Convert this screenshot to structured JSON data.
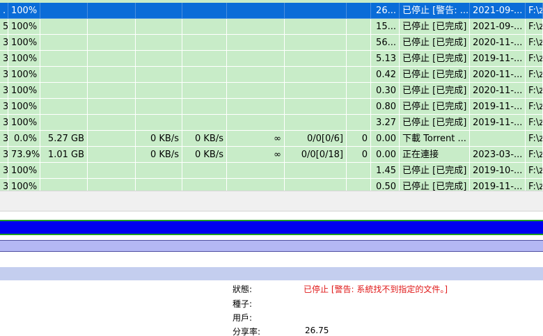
{
  "colors": {
    "selected_row": "#0a6cd8",
    "row_bg": "#c8ecc8",
    "progress": "#0000f0",
    "error_text": "#e01818"
  },
  "rows": [
    {
      "c0": ".",
      "progress": "100%",
      "size": "",
      "down_speed": "",
      "up_speed": "",
      "eta": "",
      "seeds": "",
      "peers": "",
      "ratio": "26...",
      "status": "已停止 [警告: ...",
      "added": "2021-09-...",
      "path": "F:\\z"
    },
    {
      "c0": "5",
      "progress": "100%",
      "size": "",
      "down_speed": "",
      "up_speed": "",
      "eta": "",
      "seeds": "",
      "peers": "",
      "ratio": "15...",
      "status": "已停止 [已完成]",
      "added": "2021-09-...",
      "path": "F:\\z"
    },
    {
      "c0": "3",
      "progress": "100%",
      "size": "",
      "down_speed": "",
      "up_speed": "",
      "eta": "",
      "seeds": "",
      "peers": "",
      "ratio": "56...",
      "status": "已停止 [已完成]",
      "added": "2020-11-...",
      "path": "F:\\z"
    },
    {
      "c0": "3",
      "progress": "100%",
      "size": "",
      "down_speed": "",
      "up_speed": "",
      "eta": "",
      "seeds": "",
      "peers": "",
      "ratio": "5.13",
      "status": "已停止 [已完成]",
      "added": "2019-11-...",
      "path": "F:\\z"
    },
    {
      "c0": "3",
      "progress": "100%",
      "size": "",
      "down_speed": "",
      "up_speed": "",
      "eta": "",
      "seeds": "",
      "peers": "",
      "ratio": "0.42",
      "status": "已停止 [已完成]",
      "added": "2020-11-...",
      "path": "F:\\z"
    },
    {
      "c0": "3",
      "progress": "100%",
      "size": "",
      "down_speed": "",
      "up_speed": "",
      "eta": "",
      "seeds": "",
      "peers": "",
      "ratio": "0.30",
      "status": "已停止 [已完成]",
      "added": "2020-11-...",
      "path": "F:\\z"
    },
    {
      "c0": "3",
      "progress": "100%",
      "size": "",
      "down_speed": "",
      "up_speed": "",
      "eta": "",
      "seeds": "",
      "peers": "",
      "ratio": "0.80",
      "status": "已停止 [已完成]",
      "added": "2019-11-...",
      "path": "F:\\z"
    },
    {
      "c0": "3",
      "progress": "100%",
      "size": "",
      "down_speed": "",
      "up_speed": "",
      "eta": "",
      "seeds": "",
      "peers": "",
      "ratio": "3.27",
      "status": "已停止 [已完成]",
      "added": "2019-11-...",
      "path": "F:\\z"
    },
    {
      "c0": "3",
      "progress": "0.0%",
      "size": "5.27 GB",
      "down_speed": "0 KB/s",
      "up_speed": "0 KB/s",
      "eta": "∞",
      "seeds": "0/0[0/6]",
      "peers": "0",
      "ratio": "0.00",
      "status": "下載 Torrent ...",
      "added": "",
      "path": "F:\\z"
    },
    {
      "c0": "3",
      "progress": "73.9%",
      "size": "1.01 GB",
      "down_speed": "0 KB/s",
      "up_speed": "0 KB/s",
      "eta": "∞",
      "seeds": "0/0[0/18]",
      "peers": "0",
      "ratio": "0.00",
      "status": "正在連接",
      "added": "2023-03-...",
      "path": "F:\\z"
    },
    {
      "c0": "3",
      "progress": "100%",
      "size": "",
      "down_speed": "",
      "up_speed": "",
      "eta": "",
      "seeds": "",
      "peers": "",
      "ratio": "1.45",
      "status": "已停止 [已完成]",
      "added": "2019-10-...",
      "path": "F:\\z"
    },
    {
      "c0": "3",
      "progress": "100%",
      "size": "",
      "down_speed": "",
      "up_speed": "",
      "eta": "",
      "seeds": "",
      "peers": "",
      "ratio": "0.50",
      "status": "已停止 [已完成]",
      "added": "2019-11-...",
      "path": "F:\\z"
    }
  ],
  "info": {
    "status_label": "狀態:",
    "status_value": "已停止 [警告:  系統找不到指定的文件。]",
    "seed_label": "種子:",
    "user_label": "用戶:",
    "ratio_label": "分享率:",
    "ratio_value": "26.75"
  }
}
